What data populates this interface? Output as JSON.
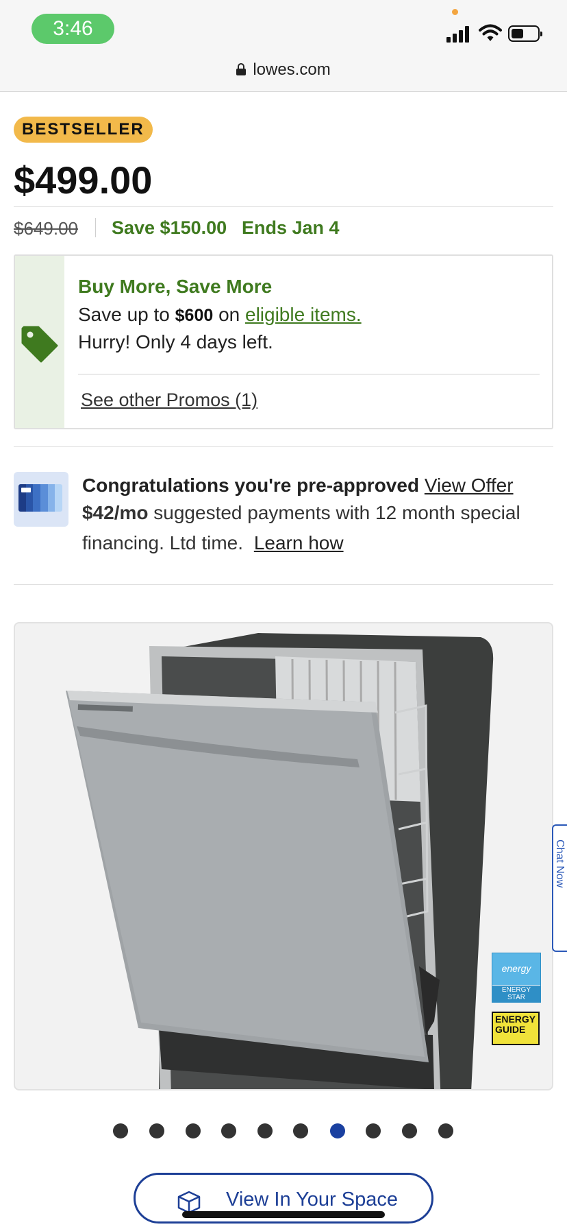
{
  "status_bar": {
    "time": "3:46"
  },
  "browser": {
    "url": "lowes.com"
  },
  "product": {
    "badge": "BESTSELLER",
    "price": "$499.00",
    "was_price": "$649.00",
    "save_text": "Save $150.00",
    "ends_text": "Ends Jan 4"
  },
  "promo": {
    "title": "Buy More, Save More",
    "line_prefix": "Save up to",
    "amount": "$600",
    "line_mid": "on",
    "link": "eligible items.",
    "hurry": "Hurry! Only 4 days left.",
    "other": "See other Promos (1)"
  },
  "financing": {
    "headline": "Congratulations you're pre-approved",
    "view_offer": "View Offer",
    "monthly": "$42/mo",
    "line2_rest": "suggested payments with 12 month special",
    "line3": "financing. Ltd time.",
    "learn_how": "Learn how"
  },
  "gallery": {
    "energy_star_logo": "energy",
    "energy_star_label": "ENERGY STAR",
    "energy_guide": "ENERGY GUIDE",
    "chat_tab": "Chat Now",
    "dots_total": 10,
    "active_dot": 7
  },
  "cta": {
    "view_in_space": "View In Your Space"
  },
  "colors": {
    "green": "#3f7a1f",
    "badge": "#f2b94a",
    "blue": "#1d3f96",
    "time_pill": "#5cc96b"
  },
  "icons": [
    "lock-icon",
    "signal-icon",
    "wifi-icon",
    "battery-icon",
    "price-tag-icon",
    "cube-icon"
  ]
}
